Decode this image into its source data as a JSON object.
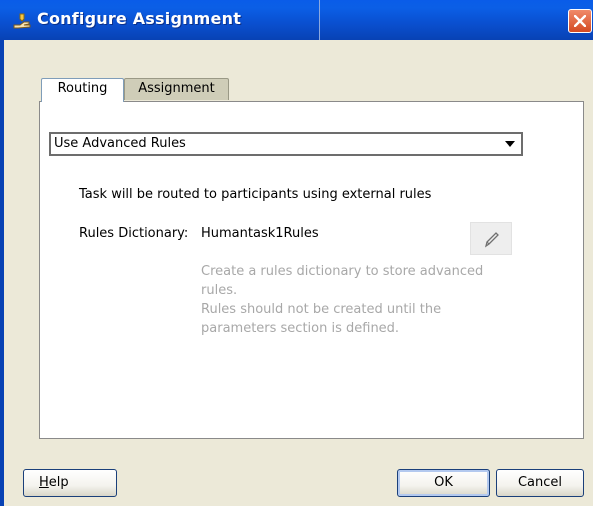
{
  "window": {
    "title": "Configure Assignment",
    "icon": "assignment-hand-icon",
    "close_icon": "close-icon"
  },
  "tabs": [
    {
      "label": "Routing",
      "selected": true
    },
    {
      "label": "Assignment",
      "selected": false
    }
  ],
  "routing": {
    "rule_select": {
      "selected": "Use Advanced Rules"
    },
    "info_text": "Task will be routed to participants using external rules",
    "dictionary_label": "Rules Dictionary:",
    "dictionary_value": "Humantask1Rules",
    "edit_icon": "pencil-icon",
    "hint_lines": [
      "Create a rules dictionary to store advanced",
      "rules.",
      "Rules should not be created until the",
      "parameters section is defined."
    ]
  },
  "buttons": {
    "help_mnemonic": "H",
    "help_rest": "elp",
    "ok": "OK",
    "cancel": "Cancel"
  },
  "colors": {
    "title_bar": "#0a4fcf",
    "close_button": "#d44a23",
    "dialog_bg": "#ece9d8",
    "hint_text": "#a8a8a8"
  }
}
